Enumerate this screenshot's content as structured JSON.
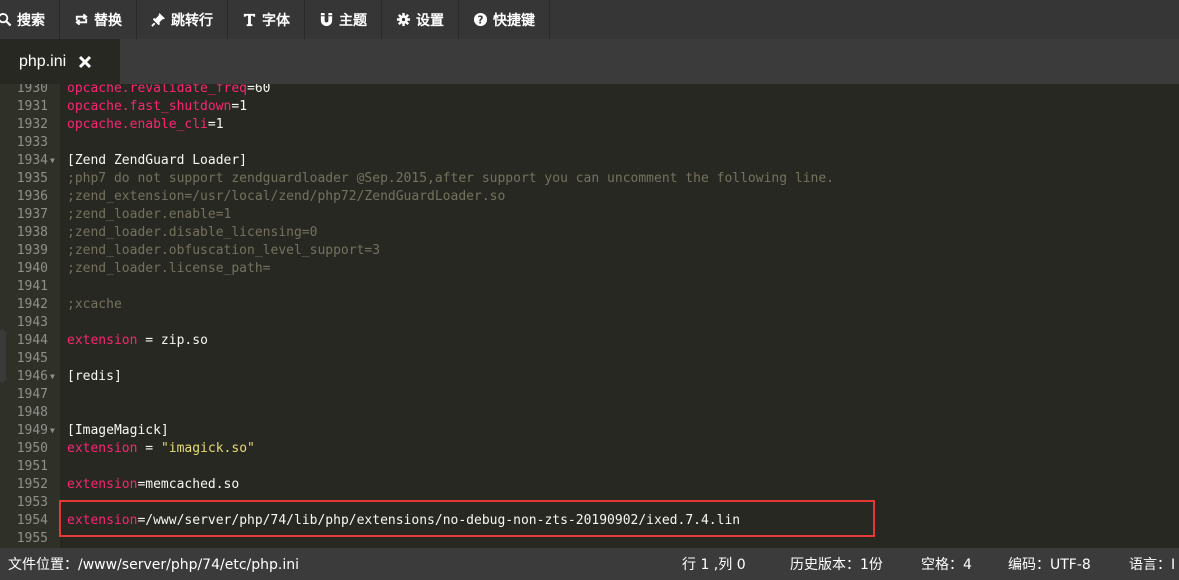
{
  "toolbar": {
    "search": "搜索",
    "replace": "替换",
    "goto": "跳转行",
    "font": "字体",
    "theme": "主题",
    "settings": "设置",
    "shortcuts": "快捷键"
  },
  "tab": {
    "label": "php.ini"
  },
  "editor": {
    "lines": [
      {
        "n": "1930"
      },
      {
        "n": "1931"
      },
      {
        "n": "1932"
      },
      {
        "n": "1933"
      },
      {
        "n": "1934"
      },
      {
        "n": "1935"
      },
      {
        "n": "1936"
      },
      {
        "n": "1937"
      },
      {
        "n": "1938"
      },
      {
        "n": "1939"
      },
      {
        "n": "1940"
      },
      {
        "n": "1941"
      },
      {
        "n": "1942"
      },
      {
        "n": "1943"
      },
      {
        "n": "1944"
      },
      {
        "n": "1945"
      },
      {
        "n": "1946"
      },
      {
        "n": "1947"
      },
      {
        "n": "1948"
      },
      {
        "n": "1949"
      },
      {
        "n": "1950"
      },
      {
        "n": "1951"
      },
      {
        "n": "1952"
      },
      {
        "n": "1953"
      },
      {
        "n": "1954"
      },
      {
        "n": "1955"
      }
    ],
    "code": {
      "l1930_key": "opcache.revalidate_freq",
      "l1930_val": "=60",
      "l1931_key": "opcache.fast_shutdown",
      "l1931_val": "=1",
      "l1932_key": "opcache.enable_cli",
      "l1932_val": "=1",
      "l1934": "[Zend ZendGuard Loader]",
      "l1935": ";php7 do not support zendguardloader @Sep.2015,after support you can uncomment the following line.",
      "l1936": ";zend_extension=/usr/local/zend/php72/ZendGuardLoader.so",
      "l1937": ";zend_loader.enable=1",
      "l1938": ";zend_loader.disable_licensing=0",
      "l1939": ";zend_loader.obfuscation_level_support=3",
      "l1940": ";zend_loader.license_path=",
      "l1942": ";xcache",
      "l1944_key": "extension",
      "l1944_val": " = zip.so",
      "l1946": "[redis]",
      "l1949": "[ImageMagick]",
      "l1950_key": "extension",
      "l1950_eq": " = ",
      "l1950_val": "\"imagick.so\"",
      "l1952_key": "extension",
      "l1952_val": "=memcached.so",
      "l1954_key": "extension",
      "l1954_val": "=/www/server/php/74/lib/php/extensions/no-debug-non-zts-20190902/ixed.7.4.lin"
    }
  },
  "status": {
    "path": "文件位置：/www/server/php/74/etc/php.ini",
    "cursor": "行 1 ,列 0",
    "history": "历史版本：1份",
    "indent": "空格：4",
    "encoding": "编码：UTF-8",
    "language": "语言：I"
  },
  "colors": {
    "background": "#272822",
    "keyword": "#f92672",
    "comment": "#75715e",
    "string": "#e6db74",
    "highlight_box": "#e53935"
  }
}
